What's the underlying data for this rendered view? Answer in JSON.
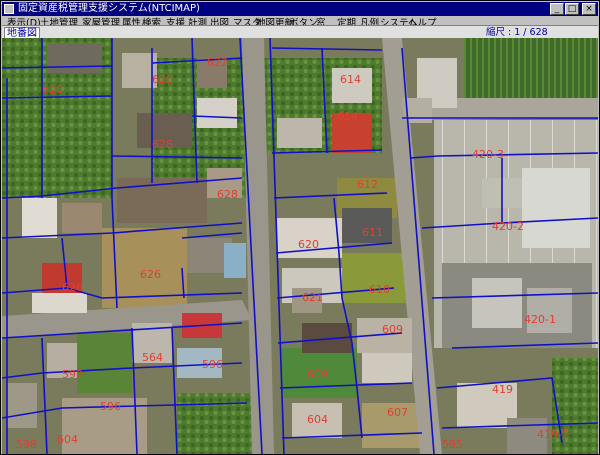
{
  "window": {
    "title": "固定資産税管理支援システム(NTCIMAP)",
    "controls": {
      "minimize": "_",
      "maximize": "□",
      "close": "×"
    }
  },
  "menu": [
    "表示(D)",
    "土地管理",
    "家屋管理",
    "属性",
    "検索",
    "支援",
    "計測",
    "出図",
    "マスタ",
    "地図更新",
    "ボタン",
    "窓",
    "定期",
    "凡例",
    "システム",
    "ヘルプ"
  ],
  "pane": {
    "title": "地番図",
    "scale_label": "縮尺 : 1 / 628"
  },
  "map": {
    "parcel_labels": [
      "620",
      "614",
      "620",
      "614",
      "628",
      "622",
      "628",
      "612",
      "620",
      "611",
      "420-3",
      "420-2",
      "626",
      "626",
      "610",
      "621",
      "420-1",
      "564",
      "596",
      "592",
      "609",
      "609",
      "596",
      "607",
      "604",
      "419",
      "419-2",
      "595",
      "598",
      "604"
    ],
    "colors": {
      "boundary": "#1010c8",
      "label": "#e04030",
      "road": "#9a968c",
      "vegetation": "#4e7a2e"
    }
  }
}
